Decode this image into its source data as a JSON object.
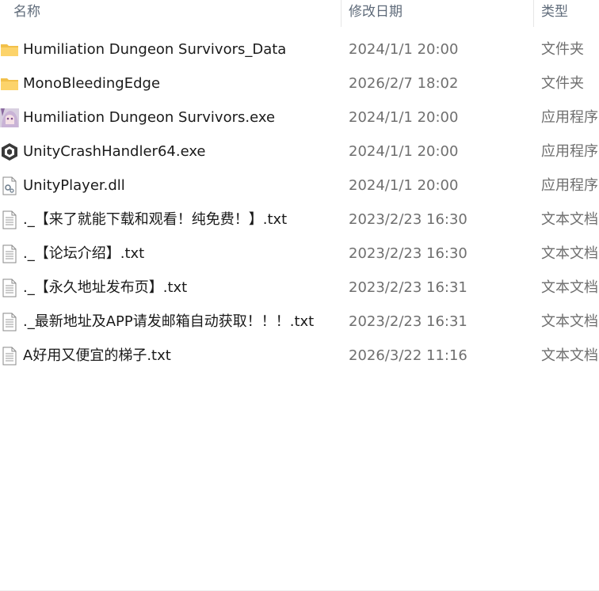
{
  "columns": {
    "name": "名称",
    "date": "修改日期",
    "type": "类型"
  },
  "files": [
    {
      "icon": "folder-icon",
      "name": "Humiliation Dungeon Survivors_Data",
      "date": "2024/1/1 20:00",
      "type": "文件夹"
    },
    {
      "icon": "folder-icon",
      "name": "MonoBleedingEdge",
      "date": "2026/2/7 18:02",
      "type": "文件夹"
    },
    {
      "icon": "game-app-icon",
      "name": "Humiliation Dungeon Survivors.exe",
      "date": "2024/1/1 20:00",
      "type": "应用程序"
    },
    {
      "icon": "unity-icon",
      "name": "UnityCrashHandler64.exe",
      "date": "2024/1/1 20:00",
      "type": "应用程序"
    },
    {
      "icon": "dll-icon",
      "name": "UnityPlayer.dll",
      "date": "2024/1/1 20:00",
      "type": "应用程序"
    },
    {
      "icon": "text-file-icon",
      "name": "._【来了就能下载和观看！纯免费！】.txt",
      "date": "2023/2/23 16:30",
      "type": "文本文档"
    },
    {
      "icon": "text-file-icon",
      "name": "._【论坛介绍】.txt",
      "date": "2023/2/23 16:30",
      "type": "文本文档"
    },
    {
      "icon": "text-file-icon",
      "name": "._【永久地址发布页】.txt",
      "date": "2023/2/23 16:31",
      "type": "文本文档"
    },
    {
      "icon": "text-file-icon",
      "name": "._最新地址及APP请发邮箱自动获取！！！.txt",
      "date": "2023/2/23 16:31",
      "type": "文本文档"
    },
    {
      "icon": "text-file-icon",
      "name": "A好用又便宜的梯子.txt",
      "date": "2026/3/22 11:16",
      "type": "文本文档"
    }
  ]
}
